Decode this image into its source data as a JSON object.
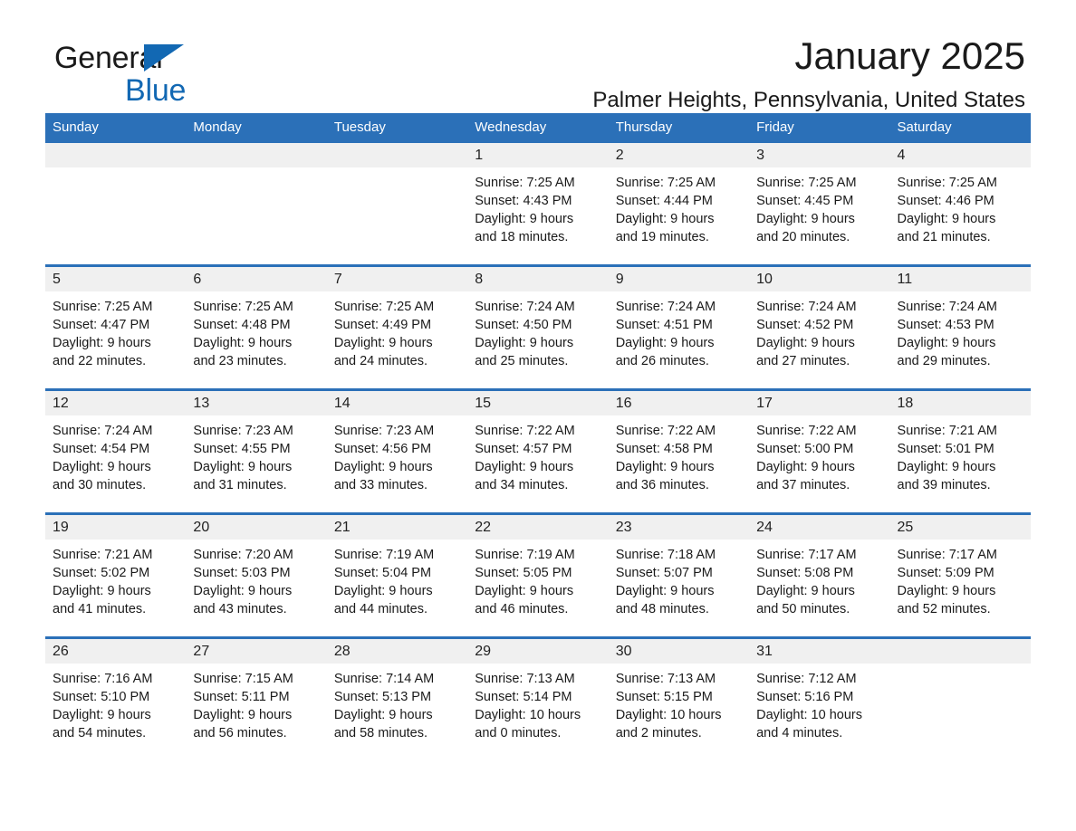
{
  "brand": {
    "name_line1": "General",
    "name_line2": "Blue",
    "accent_color": "#1268b3",
    "triangle_icon": "triangle-icon"
  },
  "header": {
    "title": "January 2025",
    "location": "Palmer Heights, Pennsylvania, United States"
  },
  "calendar": {
    "header_bg": "#2b70b8",
    "daynum_bg": "#f0f0f0",
    "weekday_headers": [
      "Sunday",
      "Monday",
      "Tuesday",
      "Wednesday",
      "Thursday",
      "Friday",
      "Saturday"
    ],
    "weeks": [
      [
        {
          "empty": true
        },
        {
          "empty": true
        },
        {
          "empty": true
        },
        {
          "day": "1",
          "sunrise": "Sunrise: 7:25 AM",
          "sunset": "Sunset: 4:43 PM",
          "daylight_line1": "Daylight: 9 hours",
          "daylight_line2": "and 18 minutes."
        },
        {
          "day": "2",
          "sunrise": "Sunrise: 7:25 AM",
          "sunset": "Sunset: 4:44 PM",
          "daylight_line1": "Daylight: 9 hours",
          "daylight_line2": "and 19 minutes."
        },
        {
          "day": "3",
          "sunrise": "Sunrise: 7:25 AM",
          "sunset": "Sunset: 4:45 PM",
          "daylight_line1": "Daylight: 9 hours",
          "daylight_line2": "and 20 minutes."
        },
        {
          "day": "4",
          "sunrise": "Sunrise: 7:25 AM",
          "sunset": "Sunset: 4:46 PM",
          "daylight_line1": "Daylight: 9 hours",
          "daylight_line2": "and 21 minutes."
        }
      ],
      [
        {
          "day": "5",
          "sunrise": "Sunrise: 7:25 AM",
          "sunset": "Sunset: 4:47 PM",
          "daylight_line1": "Daylight: 9 hours",
          "daylight_line2": "and 22 minutes."
        },
        {
          "day": "6",
          "sunrise": "Sunrise: 7:25 AM",
          "sunset": "Sunset: 4:48 PM",
          "daylight_line1": "Daylight: 9 hours",
          "daylight_line2": "and 23 minutes."
        },
        {
          "day": "7",
          "sunrise": "Sunrise: 7:25 AM",
          "sunset": "Sunset: 4:49 PM",
          "daylight_line1": "Daylight: 9 hours",
          "daylight_line2": "and 24 minutes."
        },
        {
          "day": "8",
          "sunrise": "Sunrise: 7:24 AM",
          "sunset": "Sunset: 4:50 PM",
          "daylight_line1": "Daylight: 9 hours",
          "daylight_line2": "and 25 minutes."
        },
        {
          "day": "9",
          "sunrise": "Sunrise: 7:24 AM",
          "sunset": "Sunset: 4:51 PM",
          "daylight_line1": "Daylight: 9 hours",
          "daylight_line2": "and 26 minutes."
        },
        {
          "day": "10",
          "sunrise": "Sunrise: 7:24 AM",
          "sunset": "Sunset: 4:52 PM",
          "daylight_line1": "Daylight: 9 hours",
          "daylight_line2": "and 27 minutes."
        },
        {
          "day": "11",
          "sunrise": "Sunrise: 7:24 AM",
          "sunset": "Sunset: 4:53 PM",
          "daylight_line1": "Daylight: 9 hours",
          "daylight_line2": "and 29 minutes."
        }
      ],
      [
        {
          "day": "12",
          "sunrise": "Sunrise: 7:24 AM",
          "sunset": "Sunset: 4:54 PM",
          "daylight_line1": "Daylight: 9 hours",
          "daylight_line2": "and 30 minutes."
        },
        {
          "day": "13",
          "sunrise": "Sunrise: 7:23 AM",
          "sunset": "Sunset: 4:55 PM",
          "daylight_line1": "Daylight: 9 hours",
          "daylight_line2": "and 31 minutes."
        },
        {
          "day": "14",
          "sunrise": "Sunrise: 7:23 AM",
          "sunset": "Sunset: 4:56 PM",
          "daylight_line1": "Daylight: 9 hours",
          "daylight_line2": "and 33 minutes."
        },
        {
          "day": "15",
          "sunrise": "Sunrise: 7:22 AM",
          "sunset": "Sunset: 4:57 PM",
          "daylight_line1": "Daylight: 9 hours",
          "daylight_line2": "and 34 minutes."
        },
        {
          "day": "16",
          "sunrise": "Sunrise: 7:22 AM",
          "sunset": "Sunset: 4:58 PM",
          "daylight_line1": "Daylight: 9 hours",
          "daylight_line2": "and 36 minutes."
        },
        {
          "day": "17",
          "sunrise": "Sunrise: 7:22 AM",
          "sunset": "Sunset: 5:00 PM",
          "daylight_line1": "Daylight: 9 hours",
          "daylight_line2": "and 37 minutes."
        },
        {
          "day": "18",
          "sunrise": "Sunrise: 7:21 AM",
          "sunset": "Sunset: 5:01 PM",
          "daylight_line1": "Daylight: 9 hours",
          "daylight_line2": "and 39 minutes."
        }
      ],
      [
        {
          "day": "19",
          "sunrise": "Sunrise: 7:21 AM",
          "sunset": "Sunset: 5:02 PM",
          "daylight_line1": "Daylight: 9 hours",
          "daylight_line2": "and 41 minutes."
        },
        {
          "day": "20",
          "sunrise": "Sunrise: 7:20 AM",
          "sunset": "Sunset: 5:03 PM",
          "daylight_line1": "Daylight: 9 hours",
          "daylight_line2": "and 43 minutes."
        },
        {
          "day": "21",
          "sunrise": "Sunrise: 7:19 AM",
          "sunset": "Sunset: 5:04 PM",
          "daylight_line1": "Daylight: 9 hours",
          "daylight_line2": "and 44 minutes."
        },
        {
          "day": "22",
          "sunrise": "Sunrise: 7:19 AM",
          "sunset": "Sunset: 5:05 PM",
          "daylight_line1": "Daylight: 9 hours",
          "daylight_line2": "and 46 minutes."
        },
        {
          "day": "23",
          "sunrise": "Sunrise: 7:18 AM",
          "sunset": "Sunset: 5:07 PM",
          "daylight_line1": "Daylight: 9 hours",
          "daylight_line2": "and 48 minutes."
        },
        {
          "day": "24",
          "sunrise": "Sunrise: 7:17 AM",
          "sunset": "Sunset: 5:08 PM",
          "daylight_line1": "Daylight: 9 hours",
          "daylight_line2": "and 50 minutes."
        },
        {
          "day": "25",
          "sunrise": "Sunrise: 7:17 AM",
          "sunset": "Sunset: 5:09 PM",
          "daylight_line1": "Daylight: 9 hours",
          "daylight_line2": "and 52 minutes."
        }
      ],
      [
        {
          "day": "26",
          "sunrise": "Sunrise: 7:16 AM",
          "sunset": "Sunset: 5:10 PM",
          "daylight_line1": "Daylight: 9 hours",
          "daylight_line2": "and 54 minutes."
        },
        {
          "day": "27",
          "sunrise": "Sunrise: 7:15 AM",
          "sunset": "Sunset: 5:11 PM",
          "daylight_line1": "Daylight: 9 hours",
          "daylight_line2": "and 56 minutes."
        },
        {
          "day": "28",
          "sunrise": "Sunrise: 7:14 AM",
          "sunset": "Sunset: 5:13 PM",
          "daylight_line1": "Daylight: 9 hours",
          "daylight_line2": "and 58 minutes."
        },
        {
          "day": "29",
          "sunrise": "Sunrise: 7:13 AM",
          "sunset": "Sunset: 5:14 PM",
          "daylight_line1": "Daylight: 10 hours",
          "daylight_line2": "and 0 minutes."
        },
        {
          "day": "30",
          "sunrise": "Sunrise: 7:13 AM",
          "sunset": "Sunset: 5:15 PM",
          "daylight_line1": "Daylight: 10 hours",
          "daylight_line2": "and 2 minutes."
        },
        {
          "day": "31",
          "sunrise": "Sunrise: 7:12 AM",
          "sunset": "Sunset: 5:16 PM",
          "daylight_line1": "Daylight: 10 hours",
          "daylight_line2": "and 4 minutes."
        },
        {
          "empty": true
        }
      ]
    ]
  }
}
